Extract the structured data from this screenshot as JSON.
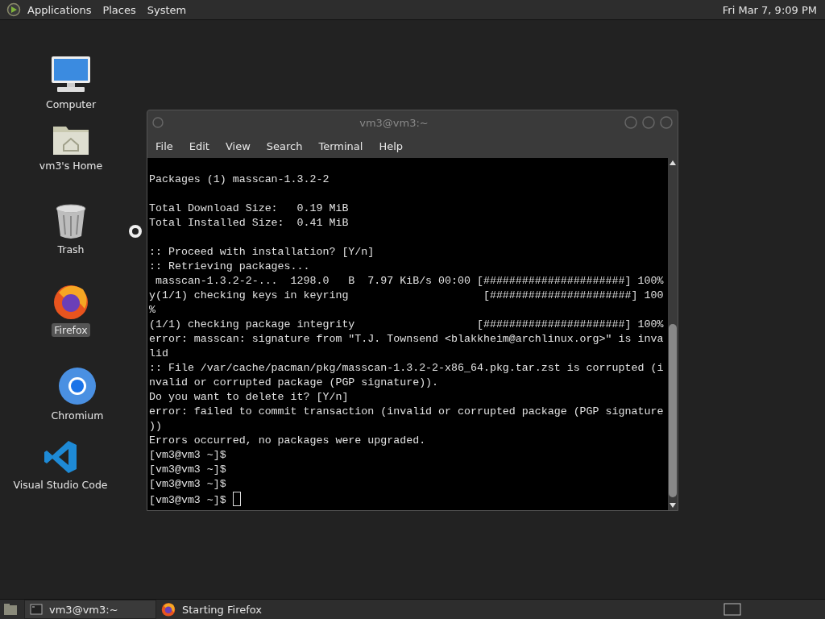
{
  "top_panel": {
    "menus": [
      "Applications",
      "Places",
      "System"
    ],
    "clock": "Fri Mar 7, 9:09 PM"
  },
  "desktop_icons": [
    {
      "kind": "computer",
      "label": "Computer",
      "selected": false
    },
    {
      "kind": "home",
      "label": "vm3's Home",
      "selected": false
    },
    {
      "kind": "trash",
      "label": "Trash",
      "selected": false
    },
    {
      "kind": "firefox",
      "label": "Firefox",
      "selected": true
    },
    {
      "kind": "chromium",
      "label": "Chromium",
      "selected": false
    },
    {
      "kind": "vscode",
      "label": "Visual Studio Code",
      "selected": false
    }
  ],
  "window": {
    "title": "vm3@vm3:~",
    "menu": [
      "File",
      "Edit",
      "View",
      "Search",
      "Terminal",
      "Help"
    ],
    "blocks": [
      [
        "Packages (1) masscan-1.3.2-2"
      ],
      [
        "Total Download Size:   0.19 MiB",
        "Total Installed Size:  0.41 MiB"
      ],
      [
        ":: Proceed with installation? [Y/n]",
        ":: Retrieving packages...",
        " masscan-1.3.2-2-...  1298.0   B  7.97 KiB/s 00:00 [######################] 100%",
        "y(1/1) checking keys in keyring                     [######################] 100",
        "%",
        "(1/1) checking package integrity                   [######################] 100%",
        "error: masscan: signature from \"T.J. Townsend <blakkheim@archlinux.org>\" is inva",
        "lid",
        ":: File /var/cache/pacman/pkg/masscan-1.3.2-2-x86_64.pkg.tar.zst is corrupted (i",
        "nvalid or corrupted package (PGP signature)).",
        "Do you want to delete it? [Y/n]",
        "error: failed to commit transaction (invalid or corrupted package (PGP signature",
        "))",
        "Errors occurred, no packages were upgraded.",
        "[vm3@vm3 ~]$",
        "[vm3@vm3 ~]$",
        "[vm3@vm3 ~]$",
        "[vm3@vm3 ~]$ "
      ]
    ]
  },
  "taskbar": [
    {
      "kind": "terminal",
      "label": "vm3@vm3:~"
    },
    {
      "kind": "firefox",
      "label": "Starting Firefox"
    }
  ]
}
